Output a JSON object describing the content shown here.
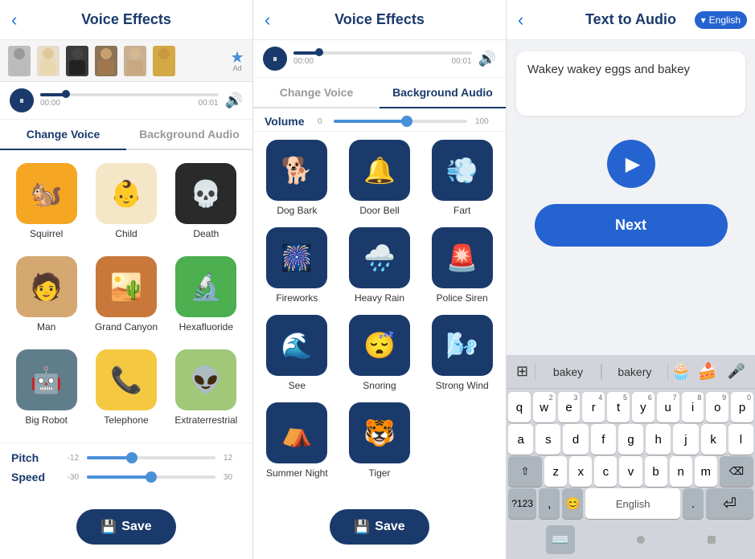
{
  "panel1": {
    "header": {
      "back": "‹",
      "title": "Voice Effects",
      "back_icon": "back"
    },
    "ad": {
      "figures": [
        "figure1",
        "figure2",
        "figure3",
        "figure4",
        "figure5",
        "figure6"
      ],
      "badge": "Ad"
    },
    "player": {
      "time_current": "00:00",
      "time_total": "00:01"
    },
    "tabs": [
      {
        "label": "Change Voice",
        "active": true
      },
      {
        "label": "Background Audio",
        "active": false
      }
    ],
    "voices": [
      {
        "label": "Squirrel",
        "emoji": "🐿️",
        "color": "#f5a623"
      },
      {
        "label": "Child",
        "emoji": "👶",
        "color": "#f5e6c8"
      },
      {
        "label": "Death",
        "emoji": "💀",
        "color": "#2a2a2a"
      },
      {
        "label": "Man",
        "emoji": "🧑",
        "color": "#d4a870"
      },
      {
        "label": "Grand Canyon",
        "emoji": "🏜️",
        "color": "#c8783a"
      },
      {
        "label": "Hexafluoride",
        "emoji": "🔬",
        "color": "#4caf50"
      },
      {
        "label": "Big Robot",
        "emoji": "🤖",
        "color": "#607d8b"
      },
      {
        "label": "Telephone",
        "emoji": "📞",
        "color": "#f5c842"
      },
      {
        "label": "Extraterrestrial",
        "emoji": "👽",
        "color": "#a0c878"
      }
    ],
    "pitch": {
      "label": "Pitch",
      "min": "-12",
      "max": "12",
      "fill_pct": 35
    },
    "speed": {
      "label": "Speed",
      "min": "-30",
      "max": "30",
      "fill_pct": 50
    },
    "pitch_speed_section": "Pitch Speed",
    "save_btn": "Save"
  },
  "panel2": {
    "header": {
      "back": "‹",
      "title": "Voice Effects"
    },
    "player": {
      "time_current": "00:00",
      "time_total": "00:01"
    },
    "tabs": [
      {
        "label": "Change Voice",
        "active": false
      },
      {
        "label": "Background Audio",
        "active": true
      }
    ],
    "volume": {
      "label": "Volume",
      "min": "0",
      "max": "100",
      "fill_pct": 55
    },
    "bg_sounds": [
      {
        "label": "Dog Bark",
        "emoji": "🐕"
      },
      {
        "label": "Door Bell",
        "emoji": "🔔"
      },
      {
        "label": "Fart",
        "emoji": "💨"
      },
      {
        "label": "Fireworks",
        "emoji": "🎆"
      },
      {
        "label": "Heavy Rain",
        "emoji": "🌧️"
      },
      {
        "label": "Police Siren",
        "emoji": "🚨"
      },
      {
        "label": "See",
        "emoji": "🌊"
      },
      {
        "label": "Snoring",
        "emoji": "😴"
      },
      {
        "label": "Strong Wind",
        "emoji": "🌬️"
      },
      {
        "label": "Summer Night",
        "emoji": "⛺"
      },
      {
        "label": "Tiger",
        "emoji": "🐯"
      }
    ],
    "save_btn": "Save"
  },
  "panel3": {
    "header": {
      "back": "‹",
      "title": "Text to Audio",
      "lang": "English",
      "lang_arrow": "▾"
    },
    "text_content": "Wakey wakey eggs and bakey",
    "next_btn": "Next",
    "keyboard": {
      "suggestions": [
        "bakey",
        "bakery",
        "🧁",
        "🍰",
        "mic"
      ],
      "rows": [
        [
          "q",
          "w",
          "e",
          "r",
          "t",
          "y",
          "u",
          "i",
          "o",
          "p"
        ],
        [
          "a",
          "s",
          "d",
          "f",
          "g",
          "h",
          "j",
          "k",
          "l"
        ],
        [
          "⇧",
          "z",
          "x",
          "c",
          "v",
          "b",
          "n",
          "m",
          "⌫"
        ],
        [
          "?123",
          ",",
          "😊",
          "space",
          ".",
          "⏎"
        ]
      ],
      "superscripts": {
        "w": "2",
        "e": "3",
        "r": "4",
        "t": "5",
        "y": "6",
        "u": "7",
        "i": "8",
        "o": "9",
        "p": "0"
      }
    }
  },
  "icons": {
    "pause": "⏸",
    "play": "▶",
    "volume": "🔊",
    "save": "💾",
    "back": "‹",
    "next_arrow": "➤"
  }
}
